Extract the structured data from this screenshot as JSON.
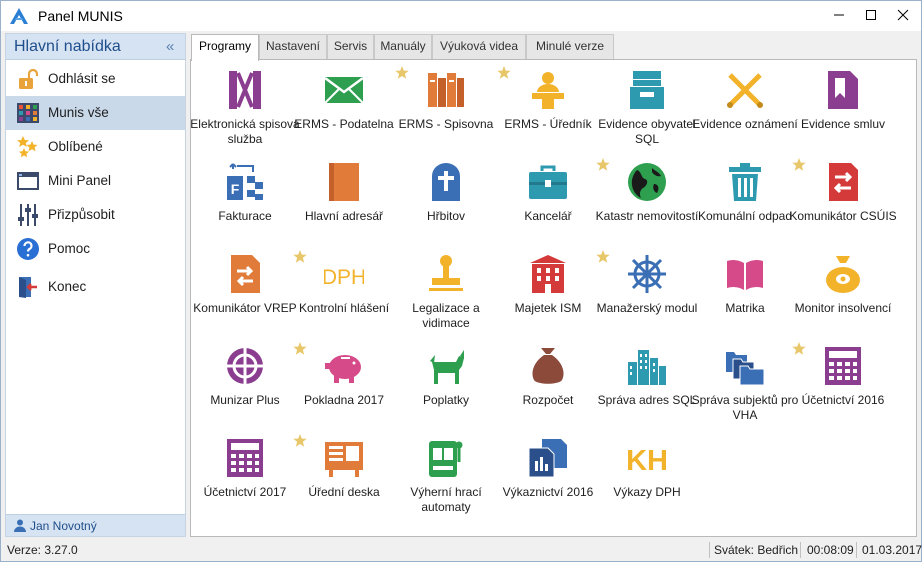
{
  "window": {
    "title": "Panel MUNIS",
    "minimize_icon": "minimize-icon",
    "maximize_icon": "maximize-icon",
    "close_icon": "close-icon"
  },
  "sidebar": {
    "title": "Hlavní nabídka",
    "collapse_glyph": "«",
    "items": [
      {
        "label": "Odhlásit se",
        "icon": "unlock-icon"
      },
      {
        "label": "Munis vše",
        "icon": "grid-icon",
        "active": true
      },
      {
        "label": "Oblíbené",
        "icon": "stars-icon"
      },
      {
        "label": "Mini Panel",
        "icon": "window-icon"
      },
      {
        "label": "Přizpůsobit",
        "icon": "sliders-icon"
      },
      {
        "label": "Pomoc",
        "icon": "help-icon"
      },
      {
        "label": "Konec",
        "icon": "exit-icon"
      }
    ],
    "user": "Jan Novotný"
  },
  "tabs": [
    {
      "label": "Programy",
      "active": true
    },
    {
      "label": "Nastavení"
    },
    {
      "label": "Servis"
    },
    {
      "label": "Manuály"
    },
    {
      "label": "Výuková videa"
    },
    {
      "label": "Minulé verze"
    }
  ],
  "apps": [
    {
      "label": "Elektronická spisová služba",
      "icon": "file-binder-icon",
      "color": "#8b3d8f",
      "favorite": false
    },
    {
      "label": "ERMS - Podatelna",
      "icon": "envelope-icon",
      "color": "#2e9e4f",
      "favorite": false
    },
    {
      "label": "ERMS - Spisovna",
      "icon": "books-icon",
      "color": "#e07b39",
      "favorite": true
    },
    {
      "label": "ERMS - Úředník",
      "icon": "clerk-icon",
      "color": "#f2b32b",
      "favorite": true
    },
    {
      "label": "Evidence obyvatel SQL",
      "icon": "card-file-icon",
      "color": "#2e9ab0",
      "favorite": false
    },
    {
      "label": "Evidence oznámení",
      "icon": "crossed-pens-icon",
      "color": "#f2b32b",
      "favorite": false
    },
    {
      "label": "Evidence smluv",
      "icon": "contract-icon",
      "color": "#8b3d8f",
      "favorite": false
    },
    {
      "label": "Fakturace",
      "icon": "invoice-icon",
      "color": "#3b6fb5",
      "favorite": false
    },
    {
      "label": "Hlavní adresář",
      "icon": "address-book-icon",
      "color": "#e07b39",
      "favorite": false
    },
    {
      "label": "Hřbitov",
      "icon": "tombstone-icon",
      "color": "#3b6fb5",
      "favorite": false
    },
    {
      "label": "Kancelář",
      "icon": "briefcase-icon",
      "color": "#2e9ab0",
      "favorite": false
    },
    {
      "label": "Katastr nemovitostí",
      "icon": "globe-icon",
      "color": "#2e9e4f",
      "favorite": true
    },
    {
      "label": "Komunální odpad",
      "icon": "trash-icon",
      "color": "#2e9ab0",
      "favorite": false
    },
    {
      "label": "Komunikátor CSÚIS",
      "icon": "exchange-doc-icon",
      "color": "#d43a3a",
      "favorite": true
    },
    {
      "label": "Komunikátor VREP",
      "icon": "exchange-file-icon",
      "color": "#e07b39",
      "favorite": false
    },
    {
      "label": "Kontrolní hlášení",
      "icon": "dph-text-icon",
      "color": "#f2b32b",
      "favorite": true
    },
    {
      "label": "Legalizace a vidimace",
      "icon": "stamp-icon",
      "color": "#f2b32b",
      "favorite": false
    },
    {
      "label": "Majetek ISM",
      "icon": "building-icon",
      "color": "#d43a3a",
      "favorite": false
    },
    {
      "label": "Manažerský modul",
      "icon": "helm-icon",
      "color": "#3b6fb5",
      "favorite": true
    },
    {
      "label": "Matrika",
      "icon": "open-book-icon",
      "color": "#d64a8a",
      "favorite": false
    },
    {
      "label": "Monitor insolvencí",
      "icon": "money-bag-icon",
      "color": "#f2b32b",
      "favorite": false
    },
    {
      "label": "Munizar Plus",
      "icon": "crosshair-icon",
      "color": "#8b3d8f",
      "favorite": false
    },
    {
      "label": "Pokladna 2017",
      "icon": "piggy-bank-icon",
      "color": "#d64a8a",
      "favorite": true
    },
    {
      "label": "Poplatky",
      "icon": "dog-icon",
      "color": "#2e9e4f",
      "favorite": false
    },
    {
      "label": "Rozpočet",
      "icon": "sack-icon",
      "color": "#8b4a3a",
      "favorite": false
    },
    {
      "label": "Správa adres SQL",
      "icon": "city-icon",
      "color": "#2e9ab0",
      "favorite": false
    },
    {
      "label": "Správa subjektů pro VHA",
      "icon": "folders-icon",
      "color": "#3b6fb5",
      "favorite": false
    },
    {
      "label": "Účetnictví 2016",
      "icon": "calculator-icon",
      "color": "#8b3d8f",
      "favorite": true
    },
    {
      "label": "Účetnictví 2017",
      "icon": "calculator-icon",
      "color": "#8b3d8f",
      "favorite": false
    },
    {
      "label": "Úřední deska",
      "icon": "notice-board-icon",
      "color": "#e07b39",
      "favorite": true
    },
    {
      "label": "Výherní hrací automaty",
      "icon": "slot-machine-icon",
      "color": "#2e9e4f",
      "favorite": false
    },
    {
      "label": "Výkaznictví 2016",
      "icon": "reports-icon",
      "color": "#3b6fb5",
      "favorite": false
    },
    {
      "label": "Výkazy DPH",
      "icon": "kh-text-icon",
      "color": "#f2b32b",
      "favorite": false
    }
  ],
  "icon_text": {
    "dph": "DPH",
    "kh": "KH"
  },
  "status": {
    "version": "Verze: 3.27.0",
    "holiday": "Svátek: Bedřich",
    "time": "00:08:09",
    "date": "01.03.2017"
  },
  "colors": {
    "accent": "#1f4e8c",
    "sidebar_header": "#d6e3f2",
    "active_item": "#c9d9ea",
    "favorite_star": "#e8c76a"
  }
}
